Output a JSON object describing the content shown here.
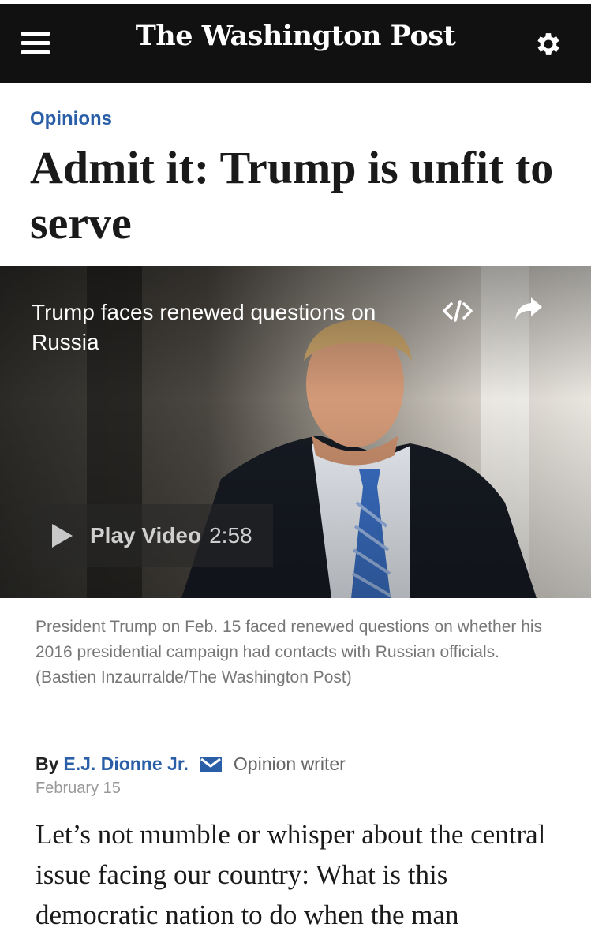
{
  "header": {
    "masthead": "The Washington Post"
  },
  "article": {
    "section": "Opinions",
    "headline": "Admit it: Trump is unfit to serve",
    "video": {
      "title": "Trump faces renewed questions on Russia",
      "play_label": "Play Video",
      "duration": "2:58"
    },
    "caption": "President Trump on Feb. 15 faced renewed questions on whether his 2016 presidential campaign had contacts with Russian officials. (Bastien Inzaurralde/The Washington Post)",
    "byline": {
      "prefix": "By",
      "author": "E.J. Dionne Jr.",
      "role": "Opinion writer",
      "date": "February 15"
    },
    "body_text": "Let’s not mumble or whisper about the central issue facing our country: What is this democratic nation to do when the man"
  },
  "icons": [
    "menu-icon",
    "gear-icon",
    "embed-icon",
    "share-icon",
    "play-icon",
    "mail-icon"
  ],
  "colors": {
    "topbar": "#111111",
    "accent_blue": "#2a5fa8",
    "caption_gray": "#777777"
  }
}
